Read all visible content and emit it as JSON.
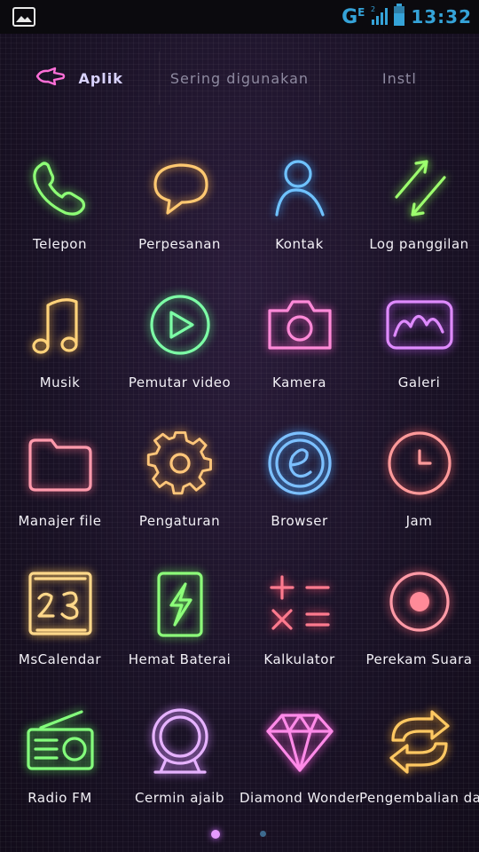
{
  "status_bar": {
    "network": "G",
    "signal_badge": "E",
    "sim": "2",
    "time": "13:32"
  },
  "tabs": [
    {
      "label": "Aplik",
      "active": true
    },
    {
      "label": "Sering digunakan",
      "active": false
    },
    {
      "label": "Instl",
      "active": false
    }
  ],
  "apps": [
    {
      "label": "Telepon",
      "icon": "phone-icon",
      "color": "#6cf05a"
    },
    {
      "label": "Perpesanan",
      "icon": "chat-bubble-icon",
      "color": "#ffb347"
    },
    {
      "label": "Kontak",
      "icon": "contact-person-icon",
      "color": "#3ea8ff"
    },
    {
      "label": "Log panggilan",
      "icon": "call-log-arrows-icon",
      "color": "#7cf046"
    },
    {
      "label": "Musik",
      "icon": "music-note-icon",
      "color": "#ffc04a"
    },
    {
      "label": "Pemutar video",
      "icon": "play-circle-icon",
      "color": "#5ef08a"
    },
    {
      "label": "Kamera",
      "icon": "camera-icon",
      "color": "#ff5fc8"
    },
    {
      "label": "Galeri",
      "icon": "gallery-icon",
      "color": "#c85cff"
    },
    {
      "label": "Manajer file",
      "icon": "folder-icon",
      "color": "#ff6f8a"
    },
    {
      "label": "Pengaturan",
      "icon": "gear-icon",
      "color": "#ffb04a"
    },
    {
      "label": "Browser",
      "icon": "browser-e-icon",
      "color": "#4aa8ff"
    },
    {
      "label": "Jam",
      "icon": "clock-icon",
      "color": "#ff6a6a"
    },
    {
      "label": "MsCalendar",
      "icon": "calendar-icon",
      "color": "#ffc85a"
    },
    {
      "label": "Hemat Baterai",
      "icon": "battery-bolt-icon",
      "color": "#6cf05a"
    },
    {
      "label": "Kalkulator",
      "icon": "calculator-icon",
      "color": "#ff4f6a"
    },
    {
      "label": "Perekam Suara",
      "icon": "record-icon",
      "color": "#ff6a7a"
    },
    {
      "label": "Radio FM",
      "icon": "radio-icon",
      "color": "#5ef05a"
    },
    {
      "label": "Cermin ajaib",
      "icon": "mirror-icon",
      "color": "#d58cff"
    },
    {
      "label": "Diamond Wonders",
      "icon": "diamond-icon",
      "color": "#ff5fe0"
    },
    {
      "label": "Pengembalian data",
      "icon": "restore-arrows-icon",
      "color": "#ffb030"
    }
  ],
  "page_indicator": {
    "current": 1,
    "total": 2
  }
}
